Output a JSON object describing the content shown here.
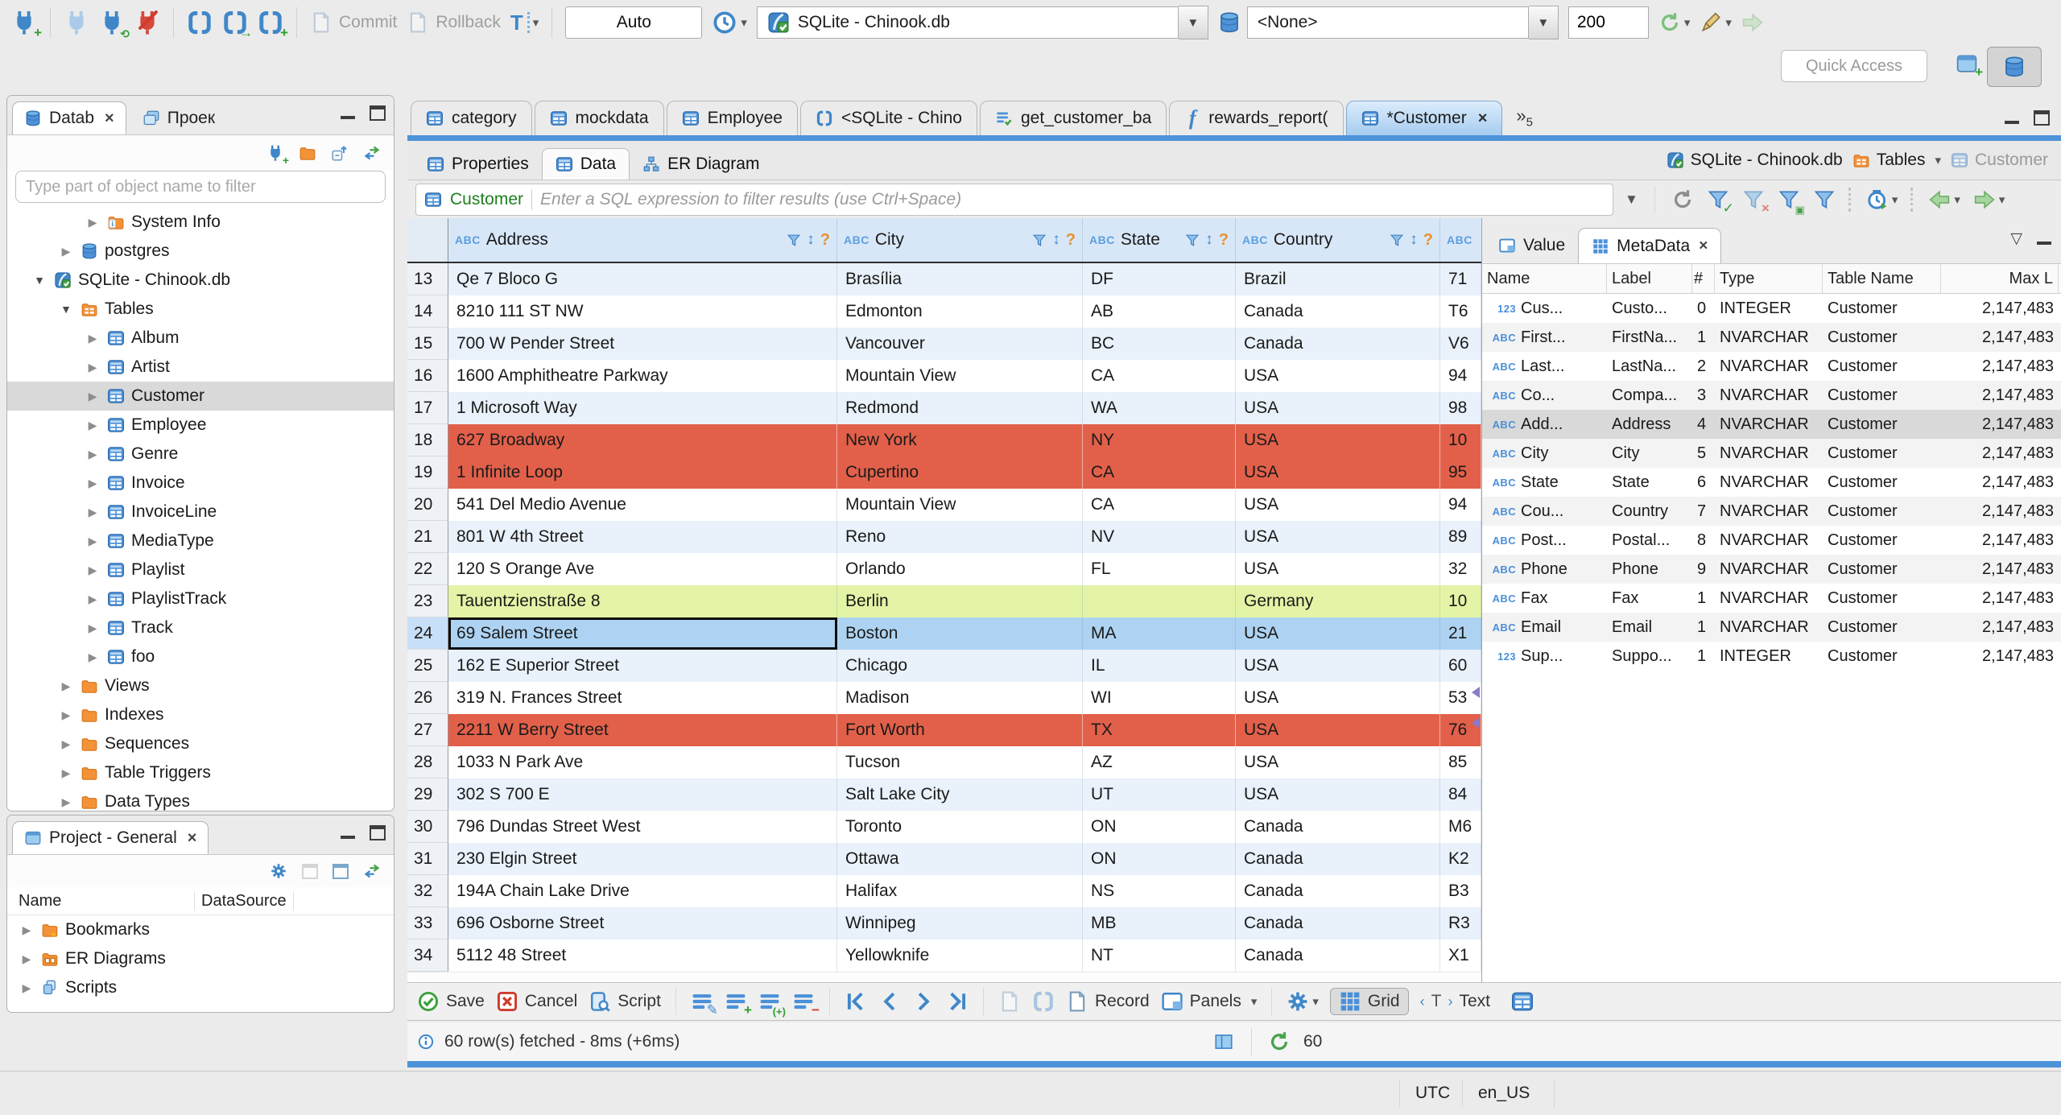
{
  "colors": {
    "accent": "#4d93da",
    "row_red": "#e2604a",
    "row_green": "#e3f4a6",
    "row_selected": "#aed3f2",
    "grid_header_bg": "#d7e7f8"
  },
  "toolbar": {
    "commit_label": "Commit",
    "rollback_label": "Rollback",
    "auto_label": "Auto",
    "db_combo_value": "SQLite - Chinook.db",
    "schema_combo_value": "<None>",
    "fetch_size_value": "200",
    "quick_access_label": "Quick Access"
  },
  "navigator": {
    "tabs": [
      {
        "label": "Datab",
        "closable": true
      },
      {
        "label": "Проек",
        "closable": false
      }
    ],
    "filter_placeholder": "Type part of object name to filter",
    "tree": [
      {
        "label": "System Info",
        "icon": "folder-info",
        "depth": 2,
        "state": "collapsed"
      },
      {
        "label": "postgres",
        "icon": "db",
        "depth": 1,
        "state": "collapsed"
      },
      {
        "label": "SQLite - Chinook.db",
        "icon": "sqlite",
        "depth": 0,
        "state": "expanded"
      },
      {
        "label": "Tables",
        "icon": "folder-table",
        "depth": 1,
        "state": "expanded"
      },
      {
        "label": "Album",
        "icon": "table",
        "depth": 2,
        "state": "collapsed"
      },
      {
        "label": "Artist",
        "icon": "table",
        "depth": 2,
        "state": "collapsed"
      },
      {
        "label": "Customer",
        "icon": "table",
        "depth": 2,
        "state": "collapsed",
        "selected": true
      },
      {
        "label": "Employee",
        "icon": "table",
        "depth": 2,
        "state": "collapsed"
      },
      {
        "label": "Genre",
        "icon": "table",
        "depth": 2,
        "state": "collapsed"
      },
      {
        "label": "Invoice",
        "icon": "table",
        "depth": 2,
        "state": "collapsed"
      },
      {
        "label": "InvoiceLine",
        "icon": "table",
        "depth": 2,
        "state": "collapsed"
      },
      {
        "label": "MediaType",
        "icon": "table",
        "depth": 2,
        "state": "collapsed"
      },
      {
        "label": "Playlist",
        "icon": "table",
        "depth": 2,
        "state": "collapsed"
      },
      {
        "label": "PlaylistTrack",
        "icon": "table",
        "depth": 2,
        "state": "collapsed"
      },
      {
        "label": "Track",
        "icon": "table",
        "depth": 2,
        "state": "collapsed"
      },
      {
        "label": "foo",
        "icon": "table",
        "depth": 2,
        "state": "collapsed"
      },
      {
        "label": "Views",
        "icon": "folder",
        "depth": 1,
        "state": "collapsed"
      },
      {
        "label": "Indexes",
        "icon": "folder",
        "depth": 1,
        "state": "collapsed"
      },
      {
        "label": "Sequences",
        "icon": "folder",
        "depth": 1,
        "state": "collapsed"
      },
      {
        "label": "Table Triggers",
        "icon": "folder",
        "depth": 1,
        "state": "collapsed"
      },
      {
        "label": "Data Types",
        "icon": "folder",
        "depth": 1,
        "state": "collapsed"
      }
    ]
  },
  "project": {
    "title": "Project - General",
    "columns": [
      "Name",
      "DataSource"
    ],
    "items": [
      {
        "label": "Bookmarks",
        "icon": "folder-star"
      },
      {
        "label": "ER Diagrams",
        "icon": "folder-er"
      },
      {
        "label": "Scripts",
        "icon": "scripts"
      }
    ]
  },
  "editor": {
    "tabs": [
      {
        "label": "category",
        "icon": "table"
      },
      {
        "label": "mockdata",
        "icon": "table"
      },
      {
        "label": "Employee",
        "icon": "table"
      },
      {
        "label": "<SQLite - Chino",
        "icon": "sqlpage"
      },
      {
        "label": "get_customer_ba",
        "icon": "script"
      },
      {
        "label": "rewards_report(",
        "icon": "fx"
      },
      {
        "label": "*Customer",
        "icon": "table",
        "active": true,
        "closable": true
      }
    ],
    "more_glyph": "»",
    "more_count": "5",
    "subtabs": [
      {
        "label": "Properties",
        "icon": "table"
      },
      {
        "label": "Data",
        "icon": "table",
        "active": true
      },
      {
        "label": "ER Diagram",
        "icon": "diagram"
      }
    ],
    "breadcrumb": {
      "db": "SQLite - Chinook.db",
      "container": "Tables",
      "entity": "Customer"
    }
  },
  "filter_bar": {
    "entity": "Customer",
    "placeholder": "Enter a SQL expression to filter results (use Ctrl+Space)"
  },
  "grid": {
    "header_badge": "ABC",
    "columns": [
      "Address",
      "City",
      "State",
      "Country"
    ],
    "rows": [
      {
        "num": "13",
        "address": "Qe 7 Bloco G",
        "city": "Brasília",
        "state": "DF",
        "country": "Brazil",
        "extra": "71",
        "style": "alt"
      },
      {
        "num": "14",
        "address": "8210 111 ST NW",
        "city": "Edmonton",
        "state": "AB",
        "country": "Canada",
        "extra": "T6",
        "style": "white"
      },
      {
        "num": "15",
        "address": "700 W Pender Street",
        "city": "Vancouver",
        "state": "BC",
        "country": "Canada",
        "extra": "V6",
        "style": "alt"
      },
      {
        "num": "16",
        "address": "1600 Amphitheatre Parkway",
        "city": "Mountain View",
        "state": "CA",
        "country": "USA",
        "extra": "94",
        "style": "white"
      },
      {
        "num": "17",
        "address": "1 Microsoft Way",
        "city": "Redmond",
        "state": "WA",
        "country": "USA",
        "extra": "98",
        "style": "alt"
      },
      {
        "num": "18",
        "address": "627 Broadway",
        "city": "New York",
        "state": "NY",
        "country": "USA",
        "extra": "10",
        "style": "red"
      },
      {
        "num": "19",
        "address": "1 Infinite Loop",
        "city": "Cupertino",
        "state": "CA",
        "country": "USA",
        "extra": "95",
        "style": "red"
      },
      {
        "num": "20",
        "address": "541 Del Medio Avenue",
        "city": "Mountain View",
        "state": "CA",
        "country": "USA",
        "extra": "94",
        "style": "white"
      },
      {
        "num": "21",
        "address": "801 W 4th Street",
        "city": "Reno",
        "state": "NV",
        "country": "USA",
        "extra": "89",
        "style": "alt"
      },
      {
        "num": "22",
        "address": "120 S Orange Ave",
        "city": "Orlando",
        "state": "FL",
        "country": "USA",
        "extra": "32",
        "style": "white"
      },
      {
        "num": "23",
        "address": "Tauentzienstraße 8",
        "city": "Berlin",
        "state": "",
        "country": "Germany",
        "extra": "10",
        "style": "green"
      },
      {
        "num": "24",
        "address": "69 Salem Street",
        "city": "Boston",
        "state": "MA",
        "country": "USA",
        "extra": "21",
        "style": "sel",
        "focus": true
      },
      {
        "num": "25",
        "address": "162 E Superior Street",
        "city": "Chicago",
        "state": "IL",
        "country": "USA",
        "extra": "60",
        "style": "alt"
      },
      {
        "num": "26",
        "address": "319 N. Frances Street",
        "city": "Madison",
        "state": "WI",
        "country": "USA",
        "extra": "53",
        "style": "white"
      },
      {
        "num": "27",
        "address": "2211 W Berry Street",
        "city": "Fort Worth",
        "state": "TX",
        "country": "USA",
        "extra": "76",
        "style": "red"
      },
      {
        "num": "28",
        "address": "1033 N Park Ave",
        "city": "Tucson",
        "state": "AZ",
        "country": "USA",
        "extra": "85",
        "style": "white"
      },
      {
        "num": "29",
        "address": "302 S 700 E",
        "city": "Salt Lake City",
        "state": "UT",
        "country": "USA",
        "extra": "84",
        "style": "alt"
      },
      {
        "num": "30",
        "address": "796 Dundas Street West",
        "city": "Toronto",
        "state": "ON",
        "country": "Canada",
        "extra": "M6",
        "style": "white"
      },
      {
        "num": "31",
        "address": "230 Elgin Street",
        "city": "Ottawa",
        "state": "ON",
        "country": "Canada",
        "extra": "K2",
        "style": "alt"
      },
      {
        "num": "32",
        "address": "194A Chain Lake Drive",
        "city": "Halifax",
        "state": "NS",
        "country": "Canada",
        "extra": "B3",
        "style": "white"
      },
      {
        "num": "33",
        "address": "696 Osborne Street",
        "city": "Winnipeg",
        "state": "MB",
        "country": "Canada",
        "extra": "R3",
        "style": "alt"
      },
      {
        "num": "34",
        "address": "5112 48 Street",
        "city": "Yellowknife",
        "state": "NT",
        "country": "Canada",
        "extra": "X1",
        "style": "white"
      }
    ]
  },
  "meta": {
    "tabs": [
      {
        "label": "Value"
      },
      {
        "label": "MetaData",
        "active": true,
        "closable": true
      }
    ],
    "columns": [
      "Name",
      "Label",
      "#",
      "Type",
      "Table Name",
      "Max L"
    ],
    "rows": [
      {
        "badge": "123",
        "name": "Cus...",
        "label": "Custo...",
        "num": "0",
        "type": "INTEGER",
        "table": "Customer",
        "max": "2,147,483"
      },
      {
        "badge": "ABC",
        "name": "First...",
        "label": "FirstNa...",
        "num": "1",
        "type": "NVARCHAR",
        "table": "Customer",
        "max": "2,147,483"
      },
      {
        "badge": "ABC",
        "name": "Last...",
        "label": "LastNa...",
        "num": "2",
        "type": "NVARCHAR",
        "table": "Customer",
        "max": "2,147,483"
      },
      {
        "badge": "ABC",
        "name": "Co...",
        "label": "Compa...",
        "num": "3",
        "type": "NVARCHAR",
        "table": "Customer",
        "max": "2,147,483"
      },
      {
        "badge": "ABC",
        "name": "Add...",
        "label": "Address",
        "num": "4",
        "type": "NVARCHAR",
        "table": "Customer",
        "max": "2,147,483",
        "selected": true
      },
      {
        "badge": "ABC",
        "name": "City",
        "label": "City",
        "num": "5",
        "type": "NVARCHAR",
        "table": "Customer",
        "max": "2,147,483"
      },
      {
        "badge": "ABC",
        "name": "State",
        "label": "State",
        "num": "6",
        "type": "NVARCHAR",
        "table": "Customer",
        "max": "2,147,483"
      },
      {
        "badge": "ABC",
        "name": "Cou...",
        "label": "Country",
        "num": "7",
        "type": "NVARCHAR",
        "table": "Customer",
        "max": "2,147,483"
      },
      {
        "badge": "ABC",
        "name": "Post...",
        "label": "Postal...",
        "num": "8",
        "type": "NVARCHAR",
        "table": "Customer",
        "max": "2,147,483"
      },
      {
        "badge": "ABC",
        "name": "Phone",
        "label": "Phone",
        "num": "9",
        "type": "NVARCHAR",
        "table": "Customer",
        "max": "2,147,483"
      },
      {
        "badge": "ABC",
        "name": "Fax",
        "label": "Fax",
        "num": "1",
        "type": "NVARCHAR",
        "table": "Customer",
        "max": "2,147,483"
      },
      {
        "badge": "ABC",
        "name": "Email",
        "label": "Email",
        "num": "1",
        "type": "NVARCHAR",
        "table": "Customer",
        "max": "2,147,483"
      },
      {
        "badge": "123",
        "name": "Sup...",
        "label": "Suppo...",
        "num": "1",
        "type": "INTEGER",
        "table": "Customer",
        "max": "2,147,483"
      }
    ]
  },
  "result_toolbar": {
    "save": "Save",
    "cancel": "Cancel",
    "script": "Script",
    "record": "Record",
    "panels": "Panels",
    "grid": "Grid",
    "text": "Text"
  },
  "status": {
    "fetch_text": "60 row(s) fetched - 8ms (+6ms)",
    "refresh_count": "60"
  },
  "window_status": {
    "tz": "UTC",
    "locale": "en_US"
  }
}
